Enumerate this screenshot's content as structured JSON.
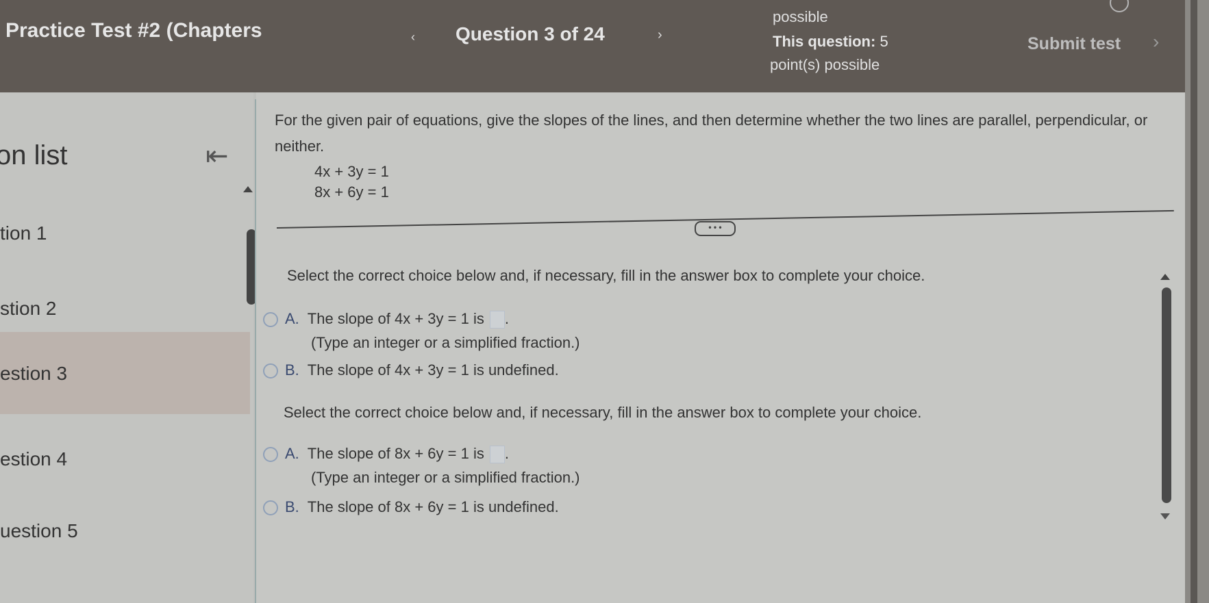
{
  "header": {
    "test_title": "Practice Test #2 (Chapters",
    "prev_icon": "chevron-left-icon",
    "prev_glyph": "‹",
    "question_indicator": "Question 3 of 24",
    "next_icon": "chevron-right-icon",
    "next_glyph": "›",
    "points_top": "possible",
    "points_label": "This question:",
    "points_value": "5",
    "points_bottom": "point(s) possible",
    "submit_label": "Submit test",
    "submit_glyph": "›"
  },
  "sidebar": {
    "title": "on list",
    "collapse_glyph": "⇤",
    "items": [
      {
        "label": "tion 1",
        "active": false
      },
      {
        "label": "stion 2",
        "active": false
      },
      {
        "label": "estion 3",
        "active": true
      },
      {
        "label": "estion 4",
        "active": false
      },
      {
        "label": "uestion 5",
        "active": false
      }
    ]
  },
  "question": {
    "instruction": "For the given pair of equations, give the slopes of the lines, and then determine whether the two lines are parallel, perpendicular, or neither.",
    "equations": [
      "4x + 3y = 1",
      "8x + 6y = 1"
    ],
    "more_label": "• • •",
    "parts": [
      {
        "prompt": "Select the correct choice below and, if necessary, fill in the answer box to complete your choice.",
        "choices": [
          {
            "letter": "A.",
            "text": "The slope of 4x + 3y = 1 is",
            "suffix": ".",
            "answer": "",
            "hint": "(Type an integer or a simplified fraction.)"
          },
          {
            "letter": "B.",
            "text": "The slope of 4x + 3y = 1 is undefined."
          }
        ]
      },
      {
        "prompt": "Select the correct choice below and, if necessary, fill in the answer box to complete your choice.",
        "choices": [
          {
            "letter": "A.",
            "text": "The slope of 8x + 6y = 1 is",
            "suffix": ".",
            "answer": "",
            "hint": "(Type an integer or a simplified fraction.)"
          },
          {
            "letter": "B.",
            "text": "The slope of 8x + 6y = 1 is undefined."
          }
        ]
      }
    ]
  }
}
